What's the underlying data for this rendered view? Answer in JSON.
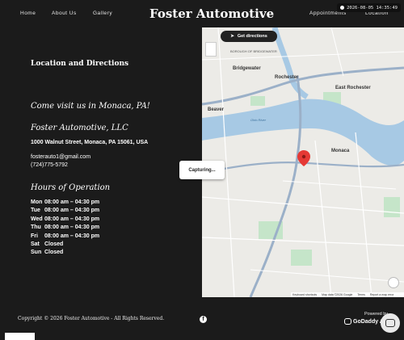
{
  "header": {
    "nav_left": [
      "Home",
      "About Us",
      "Gallery"
    ],
    "brand": "Foster Automotive",
    "nav_right": [
      "Appointments",
      "Location"
    ],
    "clock": "2026-08-05 14:35:49"
  },
  "location": {
    "section_title": "Location and Directions",
    "tagline": "Come visit us in Monaca, PA!",
    "business_name": "Foster Automotive, LLC",
    "address": "1000 Walnut Street, Monaca, PA 15061, USA",
    "email": "fosterauto1@gmail.com",
    "phone": "(724)775-5792",
    "hours_title": "Hours of Operation",
    "hours": [
      {
        "day": "Mon",
        "value": "08:00 am – 04:30 pm"
      },
      {
        "day": "Tue",
        "value": "08:00 am – 04:30 pm"
      },
      {
        "day": "Wed",
        "value": "08:00 am – 04:30 pm"
      },
      {
        "day": "Thu",
        "value": "08:00 am – 04:30 pm"
      },
      {
        "day": "Fri",
        "value": "08:00 am – 04:30 pm"
      },
      {
        "day": "Sat",
        "value": "Closed"
      },
      {
        "day": "Sun",
        "value": "Closed"
      }
    ]
  },
  "map": {
    "directions_button": "Get directions",
    "capturing": "Capturing...",
    "labels": {
      "borough": "BOROUGH OF BRIDGEWATER",
      "bridgewater": "Bridgewater",
      "rochester": "Rochester",
      "east_rochester": "East Rochester",
      "beaver": "Beaver",
      "monaca": "Monaca",
      "ohio_river": "Ohio River"
    },
    "footer": [
      "Keyboard shortcuts",
      "Map data ©2026 Google",
      "Terms",
      "Report a map error"
    ],
    "colors": {
      "water": "#a7c9e4",
      "park": "#c5e5c9",
      "road": "#ffffff",
      "highway": "#9bb0c8",
      "pin": "#e53935"
    }
  },
  "footer": {
    "copyright": "Copyright © 2026 Foster Automotive - All Rights Reserved.",
    "powered_by": "Powered by",
    "godaddy": "GoDaddy A"
  }
}
